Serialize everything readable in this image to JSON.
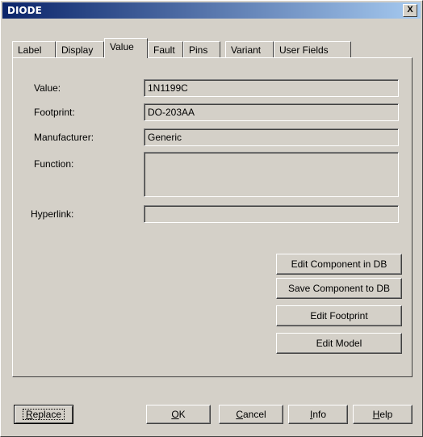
{
  "window": {
    "title": "DIODE",
    "close_label": "X"
  },
  "tabs": [
    {
      "label": "Label"
    },
    {
      "label": "Display"
    },
    {
      "label": "Value",
      "active": true
    },
    {
      "label": "Fault"
    },
    {
      "label": "Pins"
    },
    {
      "label": "Variant"
    },
    {
      "label": "User Fields"
    }
  ],
  "fields": {
    "value": {
      "label": "Value:",
      "value": "1N1199C"
    },
    "footprint": {
      "label": "Footprint:",
      "value": "DO-203AA"
    },
    "manufacturer": {
      "label": "Manufacturer:",
      "value": "Generic"
    },
    "function": {
      "label": "Function:",
      "value": ""
    },
    "hyperlink": {
      "label": "Hyperlink:",
      "value": ""
    }
  },
  "actions": {
    "edit_component_db": "Edit Component in DB",
    "save_component_db": "Save Component to DB",
    "edit_footprint": "Edit Footprint",
    "edit_model": "Edit Model"
  },
  "footer": {
    "replace": {
      "key": "R",
      "rest": "eplace"
    },
    "ok": {
      "key": "O",
      "rest": "K"
    },
    "cancel": {
      "key": "C",
      "rest": "ancel"
    },
    "info": {
      "key": "I",
      "rest": "nfo"
    },
    "help": {
      "key": "H",
      "rest": "elp"
    }
  }
}
